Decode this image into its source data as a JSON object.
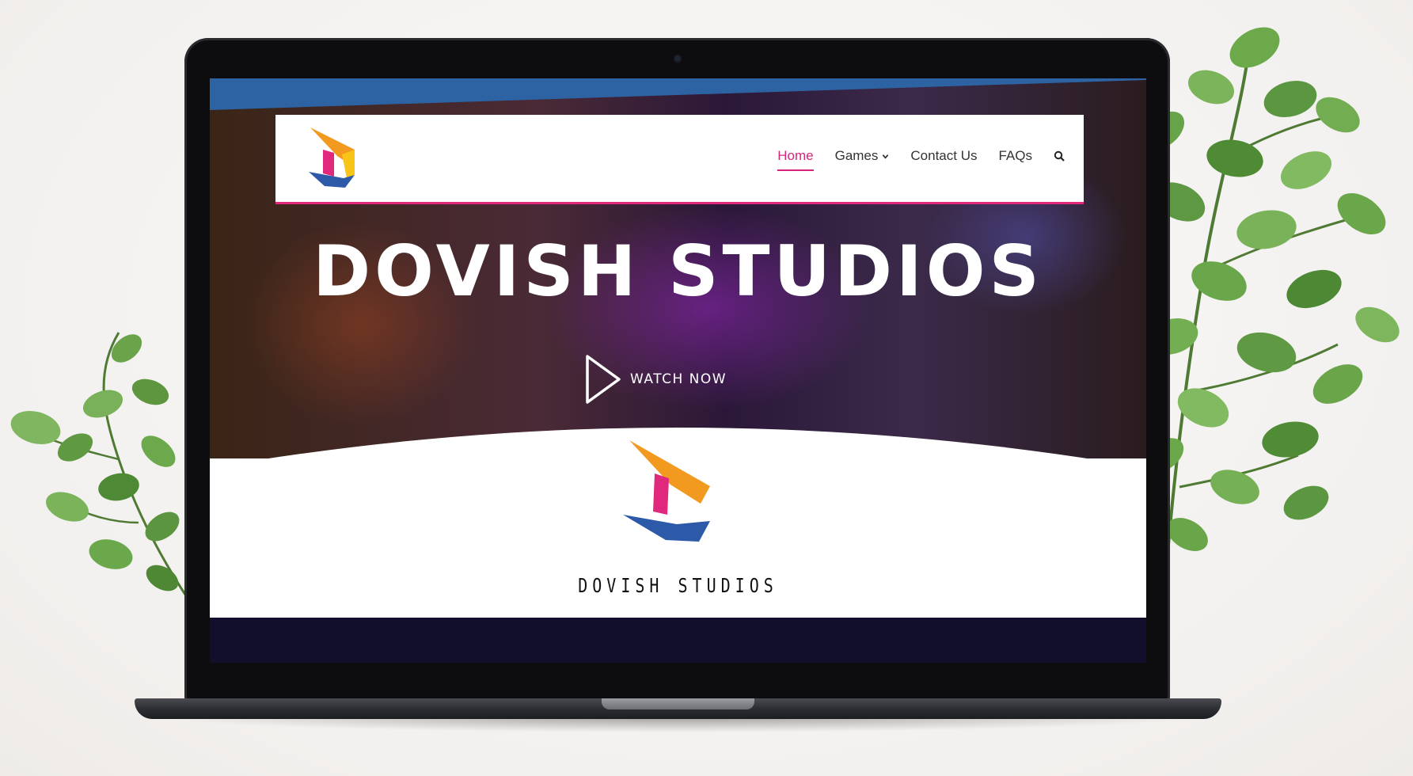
{
  "nav": {
    "items": [
      {
        "label": "Home",
        "active": true
      },
      {
        "label": "Games",
        "has_dropdown": true
      },
      {
        "label": "Contact Us"
      },
      {
        "label": "FAQs"
      }
    ],
    "search_icon": "search-icon"
  },
  "hero": {
    "title": "DOVISH STUDIOS",
    "cta_label": "WATCH NOW",
    "cta_icon": "play-icon"
  },
  "brand": {
    "name": "DOVISH STUDIOS"
  },
  "colors": {
    "accent_pink": "#e0287c",
    "brand_orange": "#f29a1f",
    "brand_blue": "#2d5aa8",
    "footer_navy": "#120f2c"
  }
}
